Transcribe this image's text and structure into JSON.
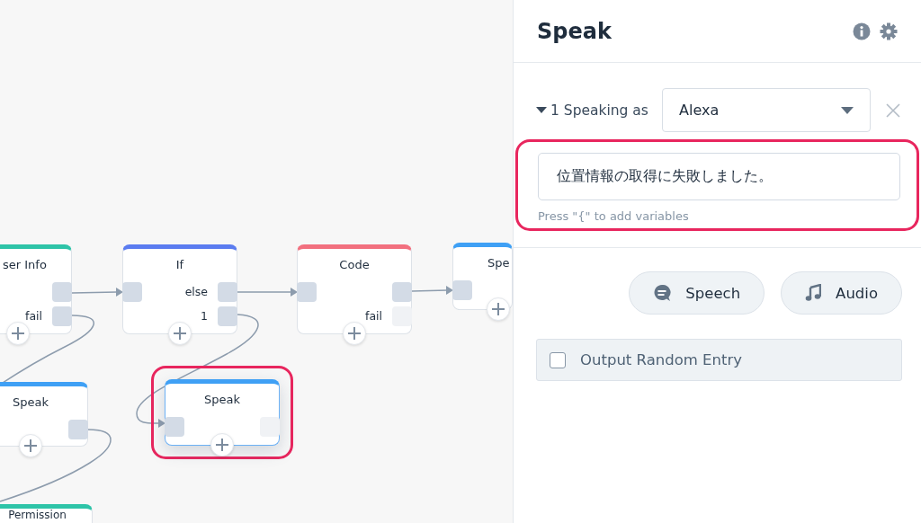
{
  "canvas": {
    "nodes": [
      {
        "title": "ser Info",
        "color": "#2ec4a8",
        "selected": false,
        "outputs": [
          {
            "connected": true
          },
          {
            "label": "fail",
            "connected": true
          }
        ]
      },
      {
        "title": "If",
        "color": "#5b7cf0",
        "has_input": true,
        "selected": false,
        "outputs": [
          {
            "label": "else",
            "connected": true
          },
          {
            "label": "1",
            "connected": true
          }
        ]
      },
      {
        "title": "Code",
        "color": "#f2707f",
        "has_input": true,
        "selected": false,
        "outputs": [
          {
            "connected": true
          },
          {
            "label": "fail",
            "connected": false
          }
        ]
      },
      {
        "title": "Spe",
        "color": "#3fa0f5",
        "has_input": true,
        "selected": false
      },
      {
        "title": "Speak",
        "color": "#3fa0f5",
        "selected": false,
        "outputs": [
          {
            "connected": true
          }
        ]
      },
      {
        "title": "Speak",
        "color": "#3fa0f5",
        "has_input": true,
        "selected": true,
        "highlighted": true,
        "outputs": [
          {
            "connected": false
          }
        ]
      },
      {
        "title": "Permission",
        "color": "#2ec4a8",
        "selected": false
      }
    ]
  },
  "panel": {
    "title": "Speak",
    "speaking_row": {
      "expanded": true,
      "label": "1 Speaking as",
      "voice": "Alexa"
    },
    "text_field": {
      "value": "位置情報の取得に失敗しました。",
      "highlighted": true
    },
    "hint": "Press \"{\" to add variables",
    "buttons": [
      {
        "label": "Speech",
        "kind": "speech"
      },
      {
        "label": "Audio",
        "kind": "audio"
      }
    ],
    "random_entry": {
      "label": "Output Random Entry",
      "checked": false
    }
  }
}
